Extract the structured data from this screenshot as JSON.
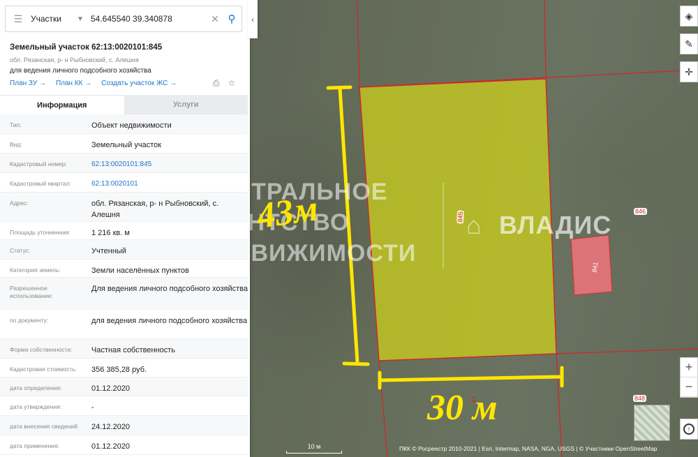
{
  "search": {
    "type": "Участки",
    "query": "54.645540 39.340878"
  },
  "object": {
    "title": "Земельный участок 62:13:0020101:845",
    "address": "обл. Рязанская, р- н Рыбновский, с. Алешня",
    "use": "для ведения личного подсобного хозяйства",
    "links": [
      "План ЗУ →",
      "План КК →",
      "Создать участок ЖС →"
    ]
  },
  "tabs": [
    "Информация",
    "Услуги"
  ],
  "info": [
    {
      "key": "Тип:",
      "value": "Объект недвижимости"
    },
    {
      "key": "Вид:",
      "value": "Земельный участок"
    },
    {
      "key": "Кадастровый номер:",
      "value": "62:13:0020101:845"
    },
    {
      "key": "Кадастровый квартал:",
      "value": "62:13:0020101"
    },
    {
      "key": "Адрес:",
      "value": "обл. Рязанская, р- н Рыбновский, с. Алешня"
    },
    {
      "key": "Площадь уточненная:",
      "value": "1 216 кв. м"
    },
    {
      "key": "Статус:",
      "value": "Учтенный"
    },
    {
      "key": "Категория земель:",
      "value": "Земли населённых пунктов"
    },
    {
      "key": "Разрешенное использование:",
      "value": "Для ведения личного подсобного хозяйства"
    },
    {
      "key": "по документу:",
      "value": "для ведения личного подсобного хозяйства"
    },
    {
      "key": "Форма собственности:",
      "value": "Частная собственность"
    },
    {
      "key": "Кадастровая стоимость:",
      "value": "356 385,28 руб."
    },
    {
      "key": "дата определения:",
      "value": "01.12.2020"
    },
    {
      "key": "дата утверждения:",
      "value": "-"
    },
    {
      "key": "дата внесения сведений:",
      "value": "24.12.2020"
    },
    {
      "key": "дата применения:",
      "value": "01.12.2020"
    }
  ],
  "map": {
    "watermark_lines": [
      "ЦЕНТРАЛЬНОЕ",
      "АГЕНТСТВО",
      "НЕДВИЖИМОСТИ"
    ],
    "watermark_brand": "ВЛАДИС",
    "dimension_height": "43м",
    "dimension_width": "30 м",
    "parcel_labels": {
      "main": "845",
      "right": "846",
      "red": "841",
      "bottom": "848",
      "bottom_partial": "47"
    },
    "scale_label": "10 м",
    "attribution": "ПКК © Росреестр 2010-2021 | Esri, Intermap, NASA, NGA, USGS | © Участники OpenStreetMap"
  },
  "colors": {
    "accent": "#1a73c8",
    "parcel_fill": "#c8cc1e",
    "parcel_red": "#e8737a",
    "boundary": "#d0262a",
    "dimension": "#ffe600"
  }
}
